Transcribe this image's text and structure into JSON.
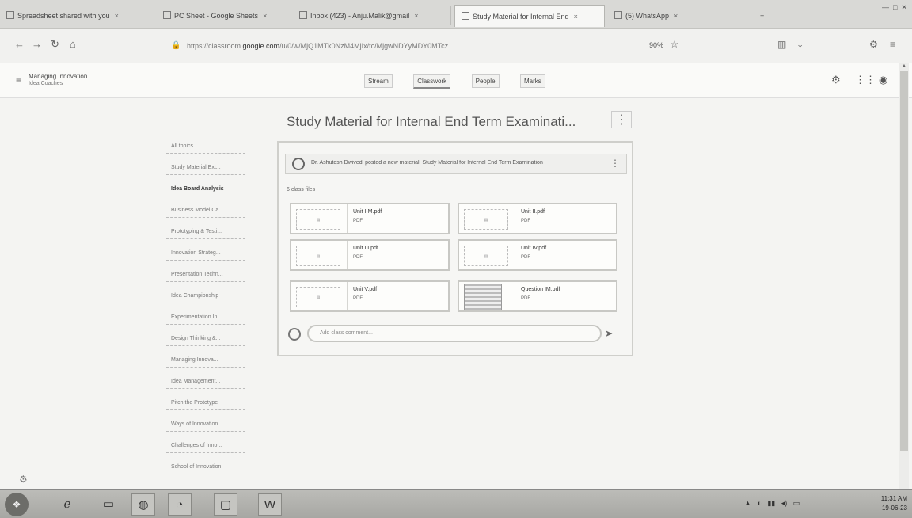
{
  "browser": {
    "tabs": [
      {
        "label": "Spreadsheet shared with you",
        "icon": "mail-icon"
      },
      {
        "label": "PC Sheet - Google Sheets",
        "icon": "sheets-icon"
      },
      {
        "label": "Inbox (423) - Anju.Malik@gmail",
        "icon": "mail-icon"
      },
      {
        "label": "Study Material for Internal End",
        "icon": "classroom-icon"
      },
      {
        "label": "(5) WhatsApp",
        "icon": "whatsapp-icon"
      }
    ],
    "new_tab": "+",
    "url_prefix": "https://classroom.",
    "url_domain": "google.com",
    "url_rest": "/u/0/w/MjQ1MTk0NzM4MjIx/tc/MjgwNDYyMDY0MTcz",
    "zoom": "90%"
  },
  "classroom": {
    "class_name": "Managing Innovation",
    "class_section": "Idea Coaches",
    "tabs": [
      "Stream",
      "Classwork",
      "People",
      "Marks"
    ],
    "active_tab": "Classwork"
  },
  "courses": [
    "All topics",
    "Study Material Ext...",
    "Idea Board Analysis",
    "Business Model Ca...",
    "Prototyping & Testi...",
    "Innovation Strateg...",
    "Presentation Techn...",
    "Idea Championship",
    "Experimentation In...",
    "Design Thinking &...",
    "Managing Innova...",
    "Idea Management...",
    "Pitch the Prototype",
    "Ways of Innovation",
    "Challenges of Inno...",
    "School of Innovation"
  ],
  "material": {
    "title": "Study Material for Internal End Term Examinati...",
    "post": "Dr. Ashutosh Dwivedi posted a new material: Study Material for Internal End Term Examination",
    "files_label": "6 class files",
    "files": [
      {
        "name": "Unit I-M.pdf",
        "type": "PDF"
      },
      {
        "name": "Unit II.pdf",
        "type": "PDF"
      },
      {
        "name": "Unit III.pdf",
        "type": "PDF"
      },
      {
        "name": "Unit IV.pdf",
        "type": "PDF"
      },
      {
        "name": "Unit V.pdf",
        "type": "PDF"
      },
      {
        "name": "Question IM.pdf",
        "type": "PDF"
      }
    ],
    "comment_placeholder": "Add class comment..."
  },
  "taskbar": {
    "time": "11:31 AM",
    "date": "19-06-23"
  }
}
